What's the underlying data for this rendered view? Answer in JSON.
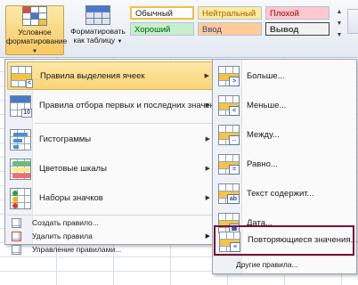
{
  "ribbon": {
    "conditional_formatting": {
      "line1": "Условное",
      "line2": "форматирование"
    },
    "format_as_table": {
      "line1": "Форматировать",
      "line2": "как таблицу"
    },
    "styles": {
      "normal": "Обычный",
      "neutral": "Нейтральный",
      "bad": "Плохой",
      "good": "Хороший",
      "input": "Ввод",
      "output": "Вывод"
    },
    "colors": {
      "cf_button_bg": "#f8c862",
      "neutral_bg": "#ffeb9c",
      "bad_bg": "#ffc7ce",
      "good_bg": "#c6efce",
      "input_bg": "#ffcc99",
      "output_bg": "#f2f2f2"
    }
  },
  "menu": {
    "items": [
      {
        "label": "Правила выделения ячеек",
        "icon": "highlight-cells-rules-icon",
        "has_submenu": true,
        "active": true
      },
      {
        "label": "Правила отбора первых и последних значений",
        "icon": "top-bottom-rules-icon",
        "has_submenu": true,
        "active": false
      },
      {
        "label": "Гистограммы",
        "icon": "data-bars-icon",
        "has_submenu": true,
        "active": false
      },
      {
        "label": "Цветовые шкалы",
        "icon": "color-scales-icon",
        "has_submenu": true,
        "active": false
      },
      {
        "label": "Наборы значков",
        "icon": "icon-sets-icon",
        "has_submenu": true,
        "active": false
      }
    ],
    "commands": [
      {
        "label": "Создать правило...",
        "icon": "new-rule-icon"
      },
      {
        "label": "Удалить правила",
        "icon": "clear-rules-icon",
        "has_submenu": true
      },
      {
        "label": "Управление правилами...",
        "icon": "manage-rules-icon"
      }
    ]
  },
  "submenu": {
    "items": [
      {
        "label": "Больше...",
        "icon": "greater-than-icon",
        "symbol": ">"
      },
      {
        "label": "Меньше...",
        "icon": "less-than-icon",
        "symbol": "<"
      },
      {
        "label": "Между...",
        "icon": "between-icon",
        "symbol": "↔"
      },
      {
        "label": "Равно...",
        "icon": "equal-to-icon",
        "symbol": "="
      },
      {
        "label": "Текст содержит...",
        "icon": "text-contains-icon",
        "symbol": "ab"
      },
      {
        "label": "Дата...",
        "icon": "date-occurring-icon",
        "symbol": "▦"
      },
      {
        "label": "Повторяющиеся значения...",
        "icon": "duplicate-values-icon",
        "symbol": "≡",
        "highlighted": true
      }
    ],
    "other": "Другие правила..."
  }
}
